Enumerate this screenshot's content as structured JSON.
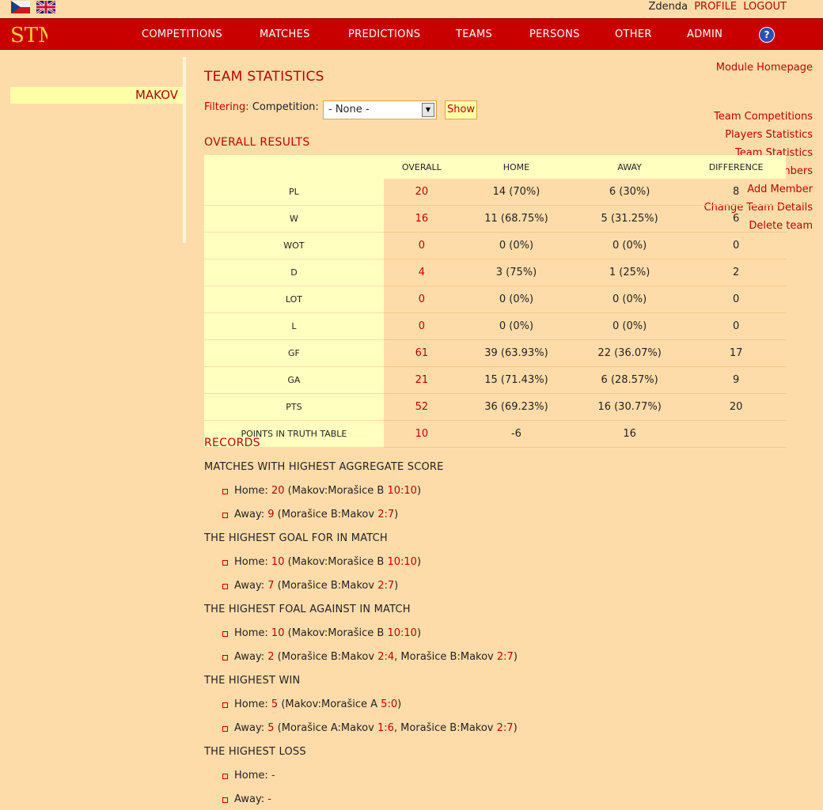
{
  "header": {
    "user_name": "Zdenda",
    "profile_label": "PROFILE",
    "logout_label": "LOGOUT"
  },
  "nav": {
    "logo_text": "STM",
    "items": [
      "COMPETITIONS",
      "MATCHES",
      "PREDICTIONS",
      "TEAMS",
      "PERSONS",
      "OTHER",
      "ADMIN"
    ],
    "help": "?"
  },
  "sidebar": {
    "module_home": "Module Homepage",
    "team_name": "MAKOV",
    "links": [
      "Team Competitions",
      "Players Statistics",
      "Team Statistics",
      "Team Members",
      "Add Member",
      "Change Team Details",
      "Delete team"
    ]
  },
  "main": {
    "title": "TEAM STATISTICS",
    "filter_label": "Filtering:",
    "competition_label": "Competition:",
    "competition_value": "- None -",
    "show_label": "Show",
    "overall_title": "OVERALL RESULTS",
    "records_title": "RECORDS"
  },
  "stats_table": {
    "headers": [
      "",
      "OVERALL",
      "HOME",
      "AWAY",
      "DIFFERENCE"
    ],
    "rows": [
      [
        "PL",
        "20",
        "14 (70%)",
        "6 (30%)",
        "8"
      ],
      [
        "W",
        "16",
        "11 (68.75%)",
        "5 (31.25%)",
        "6"
      ],
      [
        "WOT",
        "0",
        "0 (0%)",
        "0 (0%)",
        "0"
      ],
      [
        "D",
        "4",
        "3 (75%)",
        "1 (25%)",
        "2"
      ],
      [
        "LOT",
        "0",
        "0 (0%)",
        "0 (0%)",
        "0"
      ],
      [
        "L",
        "0",
        "0 (0%)",
        "0 (0%)",
        "0"
      ],
      [
        "GF",
        "61",
        "39 (63.93%)",
        "22 (36.07%)",
        "17"
      ],
      [
        "GA",
        "21",
        "15 (71.43%)",
        "6 (28.57%)",
        "9"
      ],
      [
        "PTS",
        "52",
        "36 (69.23%)",
        "16 (30.77%)",
        "20"
      ],
      [
        "POINTS IN TRUTH TABLE",
        "10",
        "-6",
        "16",
        ""
      ]
    ]
  },
  "records": {
    "sections": [
      {
        "title": "MATCHES WITH HIGHEST AGGREGATE SCORE",
        "home": {
          "label": "Home:",
          "value": "20",
          "matches": [
            {
              "teams": "Makov:Morašice B",
              "score": "10:10"
            }
          ]
        },
        "away": {
          "label": "Away:",
          "value": "9",
          "matches": [
            {
              "teams": "Morašice B:Makov",
              "score": "2:7"
            }
          ]
        }
      },
      {
        "title": "THE HIGHEST GOAL FOR IN MATCH",
        "home": {
          "label": "Home:",
          "value": "10",
          "matches": [
            {
              "teams": "Makov:Morašice B",
              "score": "10:10"
            }
          ]
        },
        "away": {
          "label": "Away:",
          "value": "7",
          "matches": [
            {
              "teams": "Morašice B:Makov",
              "score": "2:7"
            }
          ]
        }
      },
      {
        "title": "THE HIGHEST FOAL AGAINST IN MATCH",
        "home": {
          "label": "Home:",
          "value": "10",
          "matches": [
            {
              "teams": "Makov:Morašice B",
              "score": "10:10"
            }
          ]
        },
        "away": {
          "label": "Away:",
          "value": "2",
          "matches": [
            {
              "teams": "Morašice B:Makov",
              "score": "2:4"
            },
            {
              "teams": "Morašice B:Makov",
              "score": "2:7"
            }
          ]
        }
      },
      {
        "title": "THE HIGHEST WIN",
        "home": {
          "label": "Home:",
          "value": "5",
          "matches": [
            {
              "teams": "Makov:Morašice A",
              "score": "5:0"
            }
          ]
        },
        "away": {
          "label": "Away:",
          "value": "5",
          "matches": [
            {
              "teams": "Morašice A:Makov",
              "score": "1:6"
            },
            {
              "teams": "Morašice B:Makov",
              "score": "2:7"
            }
          ]
        }
      },
      {
        "title": "THE HIGHEST LOSS",
        "home": {
          "label": "Home:",
          "value": "-",
          "matches": []
        },
        "away": {
          "label": "Away:",
          "value": "-",
          "matches": []
        }
      }
    ]
  },
  "colors": {
    "background": "#fedcaa",
    "nav_red": "#c80000",
    "accent_red": "#c00000",
    "highlight_yellow": "#ffffa8"
  }
}
